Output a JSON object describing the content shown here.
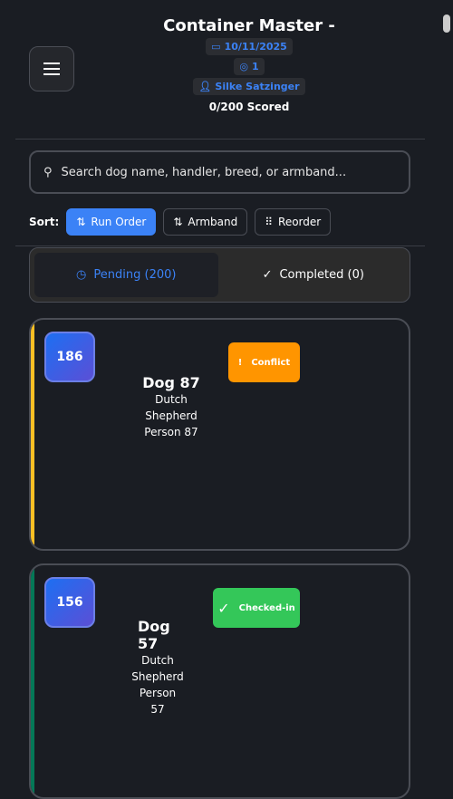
{
  "header": {
    "title": "Container Master -",
    "date": "10/11/2025",
    "level": "1",
    "judge": "Silke Satzinger",
    "scored": "0/200 Scored"
  },
  "search": {
    "placeholder": "Search dog name, handler, breed, or armband..."
  },
  "sort": {
    "label": "Sort:",
    "options": [
      "Run Order",
      "Armband",
      "Reorder"
    ]
  },
  "tabs": {
    "pending": "Pending (200)",
    "completed": "Completed (0)"
  },
  "entries": [
    {
      "armband": "186",
      "dog": "Dog 87",
      "breed_1": "Dutch",
      "breed_2": "Shepherd",
      "handler": "Person 87",
      "status": "Conflict",
      "status_icon": "!",
      "status_color": "#ff9500",
      "accent": "#fbbf24"
    },
    {
      "armband": "156",
      "dog_1": "Dog",
      "dog_2": "57",
      "breed_1": "Dutch",
      "breed_2": "Shepherd",
      "handler_1": "Person",
      "handler_2": "57",
      "status": "Checked-in",
      "status_icon": "✓",
      "status_color": "#34c759",
      "accent": "#047857"
    }
  ]
}
